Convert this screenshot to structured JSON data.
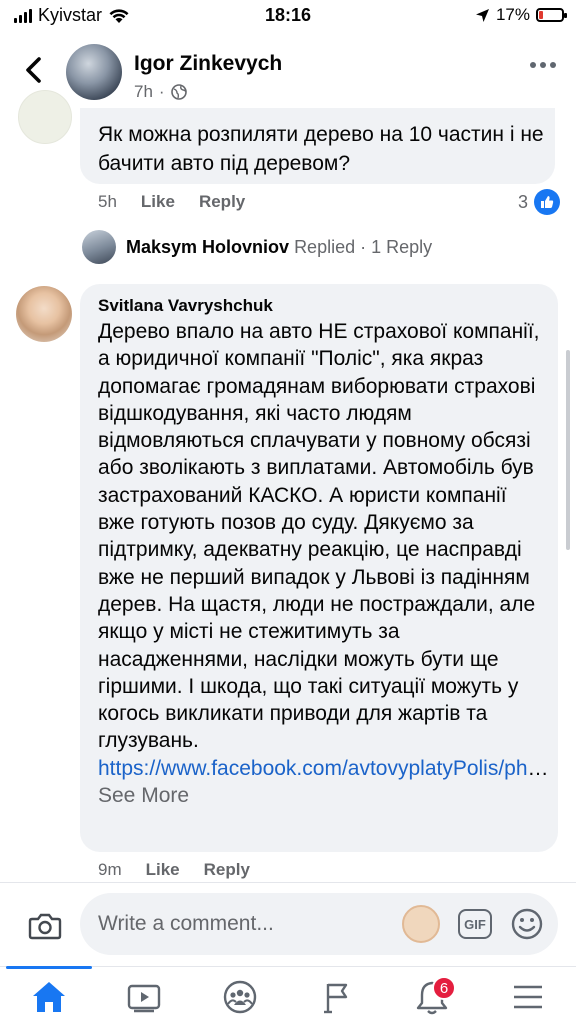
{
  "status_bar": {
    "carrier": "Kyivstar",
    "time": "18:16",
    "battery": "17%",
    "battery_level": 0.17,
    "battery_color": "#e0392f"
  },
  "header": {
    "name": "Igor Zinkevych",
    "time": "7h"
  },
  "comments": [
    {
      "text": "Як можна розпиляти дерево на 10 частин і не бачити авто під деревом?",
      "time": "5h",
      "like_label": "Like",
      "reply_label": "Reply",
      "reaction_count": "3",
      "reply_summary": {
        "name": "Maksym Holovniov",
        "action": "Replied",
        "separator": "·",
        "count": "1 Reply"
      }
    },
    {
      "author": "Svitlana Vavryshchuk",
      "text": "Дерево впало на авто НЕ страхової компанії, а юридичної компанії \"Поліс\", яка якраз допомагає громадянам виборювати страхові відшкодування, які часто людям відмовляються сплачувати у повному обсязі або зволікають з виплатами. Автомобіль був застрахований КАСКО. А юристи компанії вже готують позов до суду.  Дякуємо за підтримку, адекватну реакцію, це насправді вже не перший випадок у Львові із падінням дерев. На щастя, люди не постраждали, але якщо у місті не стежитимуть за насадженнями, наслідки можуть бути ще гіршими.  І шкода, що такі ситуації можуть у когось викликати приводи для жартів та глузувань.",
      "link": "https://www.facebook.com/avtovyplatyPolis/ph",
      "ellipsis": "…",
      "see_more": "See More",
      "time": "9m",
      "like_label": "Like",
      "reply_label": "Reply"
    }
  ],
  "composer": {
    "placeholder": "Write a comment...",
    "gif_label": "GIF"
  },
  "tabbar": {
    "notification_count": "6",
    "icons": [
      "home-icon",
      "video-icon",
      "groups-icon",
      "pages-flag-icon",
      "bell-icon",
      "menu-icon"
    ]
  },
  "colors": {
    "accent": "#1877f2",
    "bubble": "#f0f2f5",
    "secondary_text": "#65676b",
    "link": "#1b63c9",
    "badge": "#e41e3f"
  }
}
